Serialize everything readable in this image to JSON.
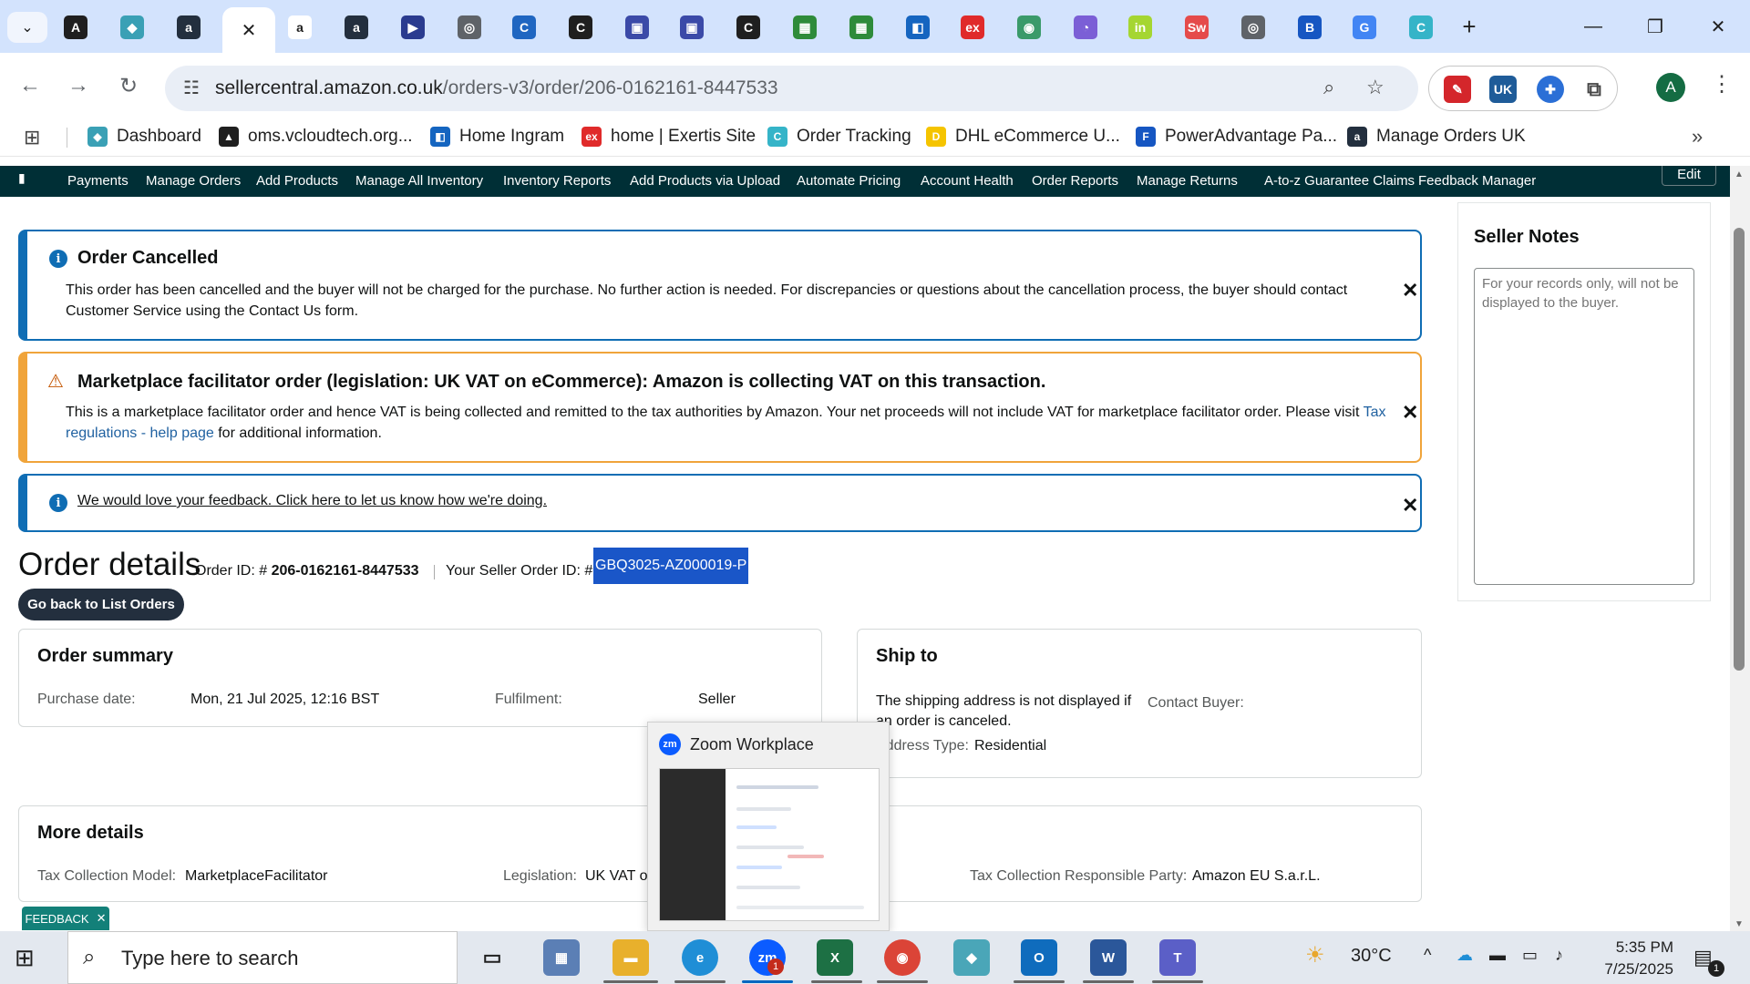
{
  "browser": {
    "url_host": "sellercentral.amazon.co.uk",
    "url_path": "/orders-v3/order/206-0162161-8447533",
    "active_tab_close": "✕",
    "profile_initial": "A",
    "new_tab_symbol": "+"
  },
  "tabs": [
    {
      "icon": "A",
      "color": "#1f1f1f"
    },
    {
      "icon": "◆",
      "color": "#3aa0b5"
    },
    {
      "icon": "a",
      "color": "#232f3e"
    },
    {
      "icon": "a",
      "color": "#ffffff"
    },
    {
      "icon": "a",
      "color": "#232f3e"
    },
    {
      "icon": "▶",
      "color": "#2a3b8f"
    },
    {
      "icon": "◎",
      "color": "#5f6368"
    },
    {
      "icon": "C",
      "color": "#1f66c1"
    },
    {
      "icon": "C",
      "color": "#1f1f1f"
    },
    {
      "icon": "▣",
      "color": "#3b4aa8"
    },
    {
      "icon": "▣",
      "color": "#3b4aa8"
    },
    {
      "icon": "C",
      "color": "#1f1f1f"
    },
    {
      "icon": "▦",
      "color": "#2e8b3a"
    },
    {
      "icon": "▦",
      "color": "#2e8b3a"
    },
    {
      "icon": "◧",
      "color": "#1565c0"
    },
    {
      "icon": "ex",
      "color": "#e02a2a"
    },
    {
      "icon": "◉",
      "color": "#3a9a6a"
    },
    {
      "icon": "◔",
      "color": "#7b5fd6"
    },
    {
      "icon": "in",
      "color": "#a5d631"
    },
    {
      "icon": "Sw",
      "color": "#e54b4b"
    },
    {
      "icon": "◎",
      "color": "#5f6368"
    },
    {
      "icon": "B",
      "color": "#1656c2"
    },
    {
      "icon": "G",
      "color": "#4285f4"
    },
    {
      "icon": "C",
      "color": "#35b4c8"
    }
  ],
  "bookmarks": [
    {
      "label": "Dashboard",
      "icon": "◆",
      "color": "#3aa0b5"
    },
    {
      "label": "oms.vcloudtech.org...",
      "icon": "▲",
      "color": "#1f1f1f"
    },
    {
      "label": "Home Ingram",
      "icon": "◧",
      "color": "#1565c0"
    },
    {
      "label": "home | Exertis Site",
      "icon": "ex",
      "color": "#e02a2a"
    },
    {
      "label": "Order Tracking",
      "icon": "C",
      "color": "#35b4c8"
    },
    {
      "label": "DHL eCommerce U...",
      "icon": "D",
      "color": "#f5c400"
    },
    {
      "label": "PowerAdvantage Pa...",
      "icon": "F",
      "color": "#1656c2"
    },
    {
      "label": "Manage Orders UK",
      "icon": "a",
      "color": "#232f3e"
    }
  ],
  "amazon_nav": {
    "items": [
      "Payments",
      "Manage Orders",
      "Add Products",
      "Manage All Inventory",
      "Inventory Reports",
      "Add Products via Upload",
      "Automate Pricing",
      "Account Health",
      "Order Reports",
      "Manage Returns",
      "A-to-z Guarantee Claims",
      "Feedback Manager"
    ],
    "edit": "Edit"
  },
  "alerts": {
    "cancelled": {
      "title": "Order Cancelled",
      "body": "This order has been cancelled and the buyer will not be charged for the purchase. No further action is needed. For discrepancies or questions about the cancellation process, the buyer should contact Customer Service using the Contact Us form."
    },
    "vat": {
      "title": "Marketplace facilitator order (legislation: UK VAT on eCommerce): Amazon is collecting VAT on this transaction.",
      "body_pre": "This is a marketplace facilitator order and hence VAT is being collected and remitted to the tax authorities by Amazon. Your net proceeds will not include VAT for marketplace facilitator order. Please visit ",
      "link": "Tax regulations - help page",
      "body_post": " for additional information."
    },
    "feedback": {
      "text": "We would love your feedback. Click here to let us know how we're doing."
    }
  },
  "order": {
    "heading": "Order details",
    "order_id_label": "Order ID: # ",
    "order_id": "206-0162161-8447533",
    "seller_order_label": "Your Seller Order ID: #",
    "seller_order_id": "GBQ3025-AZ000019-P",
    "back_button": "Go back to List Orders"
  },
  "summary": {
    "title": "Order summary",
    "purchase_date_label": "Purchase date:",
    "purchase_date": "Mon, 21 Jul 2025, 12:16 BST",
    "fulfilment_label": "Fulfilment:",
    "fulfilment": "Seller"
  },
  "ship_to": {
    "title": "Ship to",
    "note": "The shipping address is not displayed if an order is canceled.",
    "contact_label": "Contact Buyer:",
    "address_type_label": "Address Type:",
    "address_type": "Residential"
  },
  "more_details": {
    "title": "More details",
    "tax_model_label": "Tax Collection Model:",
    "tax_model": "MarketplaceFacilitator",
    "legislation_label": "Legislation:",
    "legislation": "UK VAT on eCommerce",
    "party_label": "Tax Collection Responsible Party:",
    "party": "Amazon EU S.a.r.L."
  },
  "seller_notes": {
    "title": "Seller Notes",
    "placeholder": "For your records only, will not be displayed to the buyer."
  },
  "feedback_tab": {
    "label": "FEEDBACK",
    "close": "✕"
  },
  "zoom_popup": {
    "title": "Zoom Workplace",
    "icon": "zm"
  },
  "taskbar": {
    "search_placeholder": "Type here to search",
    "weather": "30°C",
    "time": "5:35 PM",
    "date": "7/25/2025",
    "notification_count": "1",
    "zoom_badge": "1"
  }
}
